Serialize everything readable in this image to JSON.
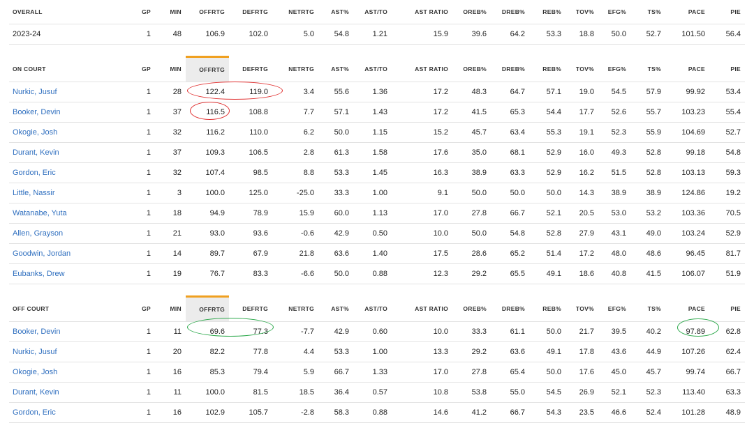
{
  "columns": [
    "GP",
    "MIN",
    "OFFRTG",
    "DEFRTG",
    "NETRTG",
    "AST%",
    "AST/TO",
    "AST RATIO",
    "OREB%",
    "DREB%",
    "REB%",
    "TOV%",
    "EFG%",
    "TS%",
    "PACE",
    "PIE"
  ],
  "overall": {
    "label": "OVERALL",
    "rows": [
      {
        "name": "2023-24",
        "values": [
          "1",
          "48",
          "106.9",
          "102.0",
          "5.0",
          "54.8",
          "1.21",
          "15.9",
          "39.6",
          "64.2",
          "53.3",
          "18.8",
          "50.0",
          "52.7",
          "101.50",
          "56.4"
        ]
      }
    ]
  },
  "on_court": {
    "label": "ON COURT",
    "rows": [
      {
        "name": "Nurkic, Jusuf",
        "values": [
          "1",
          "28",
          "122.4",
          "119.0",
          "3.4",
          "55.6",
          "1.36",
          "17.2",
          "48.3",
          "64.7",
          "57.1",
          "19.0",
          "54.5",
          "57.9",
          "99.92",
          "53.4"
        ]
      },
      {
        "name": "Booker, Devin",
        "values": [
          "1",
          "37",
          "116.5",
          "108.8",
          "7.7",
          "57.1",
          "1.43",
          "17.2",
          "41.5",
          "65.3",
          "54.4",
          "17.7",
          "52.6",
          "55.7",
          "103.23",
          "55.4"
        ]
      },
      {
        "name": "Okogie, Josh",
        "values": [
          "1",
          "32",
          "116.2",
          "110.0",
          "6.2",
          "50.0",
          "1.15",
          "15.2",
          "45.7",
          "63.4",
          "55.3",
          "19.1",
          "52.3",
          "55.9",
          "104.69",
          "52.7"
        ]
      },
      {
        "name": "Durant, Kevin",
        "values": [
          "1",
          "37",
          "109.3",
          "106.5",
          "2.8",
          "61.3",
          "1.58",
          "17.6",
          "35.0",
          "68.1",
          "52.9",
          "16.0",
          "49.3",
          "52.8",
          "99.18",
          "54.8"
        ]
      },
      {
        "name": "Gordon, Eric",
        "values": [
          "1",
          "32",
          "107.4",
          "98.5",
          "8.8",
          "53.3",
          "1.45",
          "16.3",
          "38.9",
          "63.3",
          "52.9",
          "16.2",
          "51.5",
          "52.8",
          "103.13",
          "59.3"
        ]
      },
      {
        "name": "Little, Nassir",
        "values": [
          "1",
          "3",
          "100.0",
          "125.0",
          "-25.0",
          "33.3",
          "1.00",
          "9.1",
          "50.0",
          "50.0",
          "50.0",
          "14.3",
          "38.9",
          "38.9",
          "124.86",
          "19.2"
        ]
      },
      {
        "name": "Watanabe, Yuta",
        "values": [
          "1",
          "18",
          "94.9",
          "78.9",
          "15.9",
          "60.0",
          "1.13",
          "17.0",
          "27.8",
          "66.7",
          "52.1",
          "20.5",
          "53.0",
          "53.2",
          "103.36",
          "70.5"
        ]
      },
      {
        "name": "Allen, Grayson",
        "values": [
          "1",
          "21",
          "93.0",
          "93.6",
          "-0.6",
          "42.9",
          "0.50",
          "10.0",
          "50.0",
          "54.8",
          "52.8",
          "27.9",
          "43.1",
          "49.0",
          "103.24",
          "52.9"
        ]
      },
      {
        "name": "Goodwin, Jordan",
        "values": [
          "1",
          "14",
          "89.7",
          "67.9",
          "21.8",
          "63.6",
          "1.40",
          "17.5",
          "28.6",
          "65.2",
          "51.4",
          "17.2",
          "48.0",
          "48.6",
          "96.45",
          "81.7"
        ]
      },
      {
        "name": "Eubanks, Drew",
        "values": [
          "1",
          "19",
          "76.7",
          "83.3",
          "-6.6",
          "50.0",
          "0.88",
          "12.3",
          "29.2",
          "65.5",
          "49.1",
          "18.6",
          "40.8",
          "41.5",
          "106.07",
          "51.9"
        ]
      }
    ]
  },
  "off_court": {
    "label": "OFF COURT",
    "rows": [
      {
        "name": "Booker, Devin",
        "values": [
          "1",
          "11",
          "69.6",
          "77.3",
          "-7.7",
          "42.9",
          "0.60",
          "10.0",
          "33.3",
          "61.1",
          "50.0",
          "21.7",
          "39.5",
          "40.2",
          "97.89",
          "62.8"
        ]
      },
      {
        "name": "Nurkic, Jusuf",
        "values": [
          "1",
          "20",
          "82.2",
          "77.8",
          "4.4",
          "53.3",
          "1.00",
          "13.3",
          "29.2",
          "63.6",
          "49.1",
          "17.8",
          "43.6",
          "44.9",
          "107.26",
          "62.4"
        ]
      },
      {
        "name": "Okogie, Josh",
        "values": [
          "1",
          "16",
          "85.3",
          "79.4",
          "5.9",
          "66.7",
          "1.33",
          "17.0",
          "27.8",
          "65.4",
          "50.0",
          "17.6",
          "45.0",
          "45.7",
          "99.74",
          "66.7"
        ]
      },
      {
        "name": "Durant, Kevin",
        "values": [
          "1",
          "11",
          "100.0",
          "81.5",
          "18.5",
          "36.4",
          "0.57",
          "10.8",
          "53.8",
          "55.0",
          "54.5",
          "26.9",
          "52.1",
          "52.3",
          "113.40",
          "63.3"
        ]
      },
      {
        "name": "Gordon, Eric",
        "values": [
          "1",
          "16",
          "102.9",
          "105.7",
          "-2.8",
          "58.3",
          "0.88",
          "14.6",
          "41.2",
          "66.7",
          "54.3",
          "23.5",
          "46.6",
          "52.4",
          "101.28",
          "48.9"
        ]
      }
    ]
  },
  "colors": {
    "link": "#2f6fbf",
    "sort_accent": "#f0a020",
    "circle_red": "#e03030",
    "circle_green": "#2ba84a"
  }
}
